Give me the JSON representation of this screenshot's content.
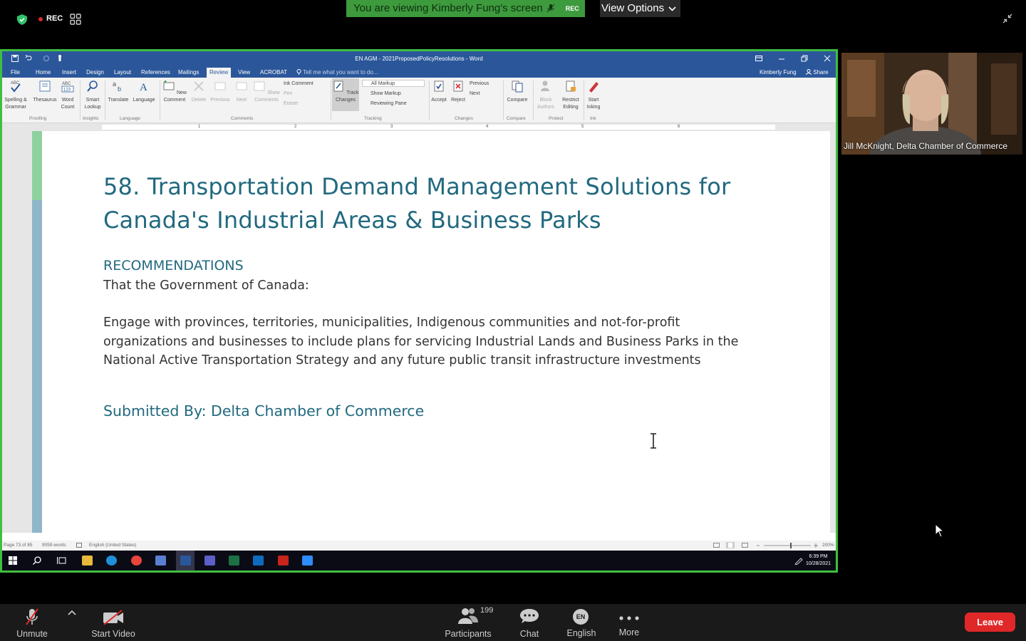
{
  "zoom_top": {
    "rec_label": "REC",
    "viewing_banner": "You are viewing Kimberly Fung's screen",
    "banner_rec": "REC",
    "view_options": "View Options"
  },
  "word": {
    "window_title": "EN AGM - 2021ProposedPolicyResolutions - Word",
    "tabs": [
      "File",
      "Home",
      "Insert",
      "Design",
      "Layout",
      "References",
      "Mailings",
      "Review",
      "View",
      "ACROBAT"
    ],
    "tell_me": "Tell me what you want to do...",
    "user": "Kimberly Fung",
    "share": "Share",
    "ribbon": {
      "spelling": "Spelling & Grammar",
      "thesaurus": "Thesaurus",
      "word_count": "Word Count",
      "smart_lookup": "Smart Lookup",
      "translate": "Translate",
      "language": "Language",
      "new_comment": "New Comment",
      "delete": "Delete",
      "previous": "Previous",
      "next": "Next",
      "show_comments": "Show Comments",
      "ink_comment": "Ink Comment",
      "pen": "Pen",
      "eraser": "Eraser",
      "track_changes": "Track Changes",
      "all_markup": "All Markup",
      "show_markup": "Show Markup",
      "reviewing_pane": "Reviewing Pane",
      "accept": "Accept",
      "reject": "Reject",
      "prev_change": "Previous",
      "next_change": "Next",
      "compare": "Compare",
      "block_authors": "Block Authors",
      "restrict_editing": "Restrict Editing",
      "start_inking": "Start Inking",
      "groups": [
        "Proofing",
        "Insights",
        "Language",
        "Comments",
        "Tracking",
        "Changes",
        "Compare",
        "Protect",
        "Ink"
      ]
    },
    "ruler_numbers": [
      "1",
      "2",
      "3",
      "4",
      "5",
      "6"
    ],
    "document": {
      "title": "58. Transportation Demand Management Solutions for Canada's Industrial Areas & Business Parks",
      "heading": "RECOMMENDATIONS",
      "intro": "That the Government of Canada:",
      "paragraph": "Engage with provinces, territories, municipalities, Indigenous communities and not-for-profit organizations and businesses to include plans for servicing Industrial Lands and Business Parks in the National Active Transportation Strategy and any future public transit infrastructure investments",
      "submitted": "Submitted By: Delta Chamber of Commerce"
    },
    "status": {
      "page": "Page 73 of 85",
      "words": "9059 words",
      "language": "English (United States)",
      "zoom": "200%"
    },
    "taskbar": {
      "time": "6:39 PM",
      "date": "10/28/2021"
    }
  },
  "participant": {
    "name": "Jill McKnight, Delta Chamber of Commerce"
  },
  "bottom_bar": {
    "unmute": "Unmute",
    "start_video": "Start Video",
    "participants": "Participants",
    "participants_count": "199",
    "chat": "Chat",
    "language": "English",
    "language_badge": "EN",
    "more": "More",
    "leave": "Leave"
  },
  "colors": {
    "zoom_green": "#3fbf3f",
    "word_blue": "#2b579a",
    "doc_heading": "#21697f",
    "leave_red": "#e02828"
  }
}
